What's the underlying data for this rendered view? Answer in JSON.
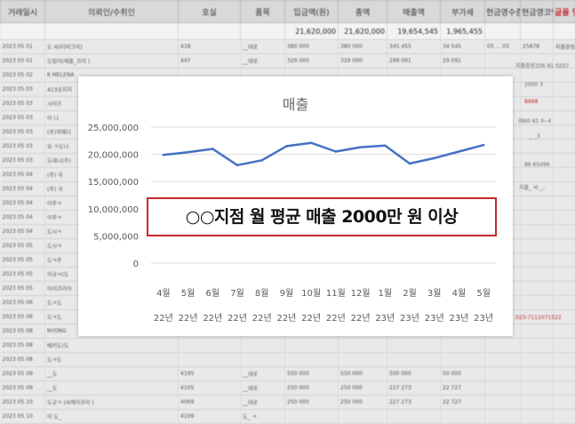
{
  "sheet": {
    "headers": [
      "거래일시",
      "의뢰인/수취인",
      "호실",
      "품목",
      "입금액(원)",
      "총액",
      "매출액",
      "부가세",
      "현금영수증",
      "현금영코멘트",
      "글꼴 및 양식"
    ],
    "totals": [
      "",
      "",
      "",
      "",
      "21,620,000",
      "21,620,000",
      "19,654,545",
      "1,965,455",
      "",
      "",
      ""
    ],
    "rows": [
      [
        "2023 05 01",
        "도  씨(티비크지)",
        "418",
        "__대로",
        "380 000",
        "380 000",
        "345 455",
        "34 545",
        "05 ... 03",
        "25878",
        "지출증빙336 81 0207"
      ],
      [
        "2023 05 01",
        "도팀리(제품_코리 )",
        "447",
        "__대로",
        "329 000",
        "329 000",
        "299 091",
        "29 091",
        "",
        "",
        ""
      ],
      [
        "2023 05 02",
        "K MELENA",
        "",
        "",
        "",
        "",
        "",
        "",
        "",
        "",
        ""
      ],
      [
        "2023 05 03",
        "413호지지",
        "",
        "",
        "",
        "",
        "",
        "",
        "",
        "",
        ""
      ],
      [
        "2023 05 03",
        "시이즈",
        "",
        "",
        "",
        "",
        "",
        "",
        "",
        "",
        ""
      ],
      [
        "2023 05 03",
        "이 니",
        "",
        "",
        "",
        "",
        "",
        "",
        "",
        "",
        ""
      ],
      [
        "2023 05 03",
        "(주)학메디",
        "",
        "",
        "",
        "",
        "",
        "",
        "",
        "",
        ""
      ],
      [
        "2023 05 03",
        "유 ㅋ도니",
        "",
        "",
        "",
        "",
        "",
        "",
        "",
        "",
        ""
      ],
      [
        "2023 05 03",
        "도대니(주)",
        "",
        "",
        "",
        "",
        "",
        "",
        "",
        "",
        ""
      ],
      [
        "2023 05 04",
        "(주) 국",
        "",
        "",
        "",
        "",
        "",
        "",
        "",
        "",
        ""
      ],
      [
        "2023 05 04",
        "(주) 국",
        "",
        "",
        "",
        "",
        "",
        "",
        "",
        "",
        ""
      ],
      [
        "2023 05 04",
        "이주ㅋ",
        "",
        "",
        "",
        "",
        "",
        "",
        "",
        "",
        ""
      ],
      [
        "2023 05 04",
        "이주ㅋ",
        "",
        "",
        "",
        "",
        "",
        "",
        "",
        "",
        ""
      ],
      [
        "2023 05 04",
        "도시ㅋ",
        "",
        "",
        "",
        "",
        "",
        "",
        "",
        "",
        ""
      ],
      [
        "2023 05 05",
        "도시ㅋ",
        "",
        "",
        "",
        "",
        "",
        "",
        "",
        "",
        ""
      ],
      [
        "2023 05 05",
        "도ㅋ주",
        "",
        "",
        "",
        "",
        "",
        "",
        "",
        "",
        ""
      ],
      [
        "2023 05 05",
        "이규ㅋ(도",
        "",
        "",
        "",
        "",
        "",
        "",
        "",
        "",
        ""
      ],
      [
        "2023 05 05",
        "티이코리아",
        "",
        "",
        "",
        "",
        "",
        "",
        "",
        "",
        ""
      ],
      [
        "2023 05 06",
        "도ㅋ도",
        "",
        "",
        "",
        "",
        "",
        "",
        "",
        "",
        ""
      ],
      [
        "2023 05 06",
        "도ㅋ도",
        "",
        "",
        "",
        "",
        "",
        "",
        "",
        "",
        ""
      ],
      [
        "2023 05 08",
        "NYONG",
        "",
        "",
        "",
        "",
        "",
        "",
        "",
        "",
        ""
      ],
      [
        "2023 05 08",
        "베키도(도",
        "",
        "",
        "",
        "",
        "",
        "",
        "",
        "",
        ""
      ],
      [
        "2023 05 08",
        "도ㅋ도",
        "",
        "",
        "",
        "",
        "",
        "",
        "",
        "",
        ""
      ],
      [
        "2023 05 09",
        "__도",
        "4195",
        "__대로",
        "550 000",
        "550 000",
        "500 000",
        "50 000",
        "",
        "",
        ""
      ],
      [
        "2023 05 09",
        "__도",
        "4105",
        "__대로",
        "250 000",
        "250 000",
        "227 273",
        "22 727",
        "",
        "",
        ""
      ],
      [
        "2023 05 10",
        "도규ㅋ (씨에이코리 )",
        "4069",
        "__대로",
        "250 000",
        "250 000",
        "227 273",
        "22 727",
        "",
        "",
        ""
      ],
      [
        "2023 05 10",
        "이 도_",
        "4199",
        "도_ ㅋ",
        "",
        "",
        "",
        "",
        "",
        "",
        ""
      ]
    ],
    "side_notes": [
      "지출증빙336 81 0207",
      "2000 3",
      "8668",
      "(860 61 0--4",
      "_ _3",
      "86 65499",
      "지출_ 씨 _..",
      "023-7111071522"
    ]
  },
  "chart_data": {
    "type": "line",
    "title": "매출",
    "categories": [
      "4월 22년",
      "5월 22년",
      "6월 22년",
      "7월 22년",
      "8월 22년",
      "9월 22년",
      "10월 22년",
      "11월 22년",
      "12월 22년",
      "1월 23년",
      "2월 23년",
      "3월 23년",
      "4월 23년",
      "5월 23년"
    ],
    "x_month_labels": [
      "4월",
      "5월",
      "6월",
      "7월",
      "8월",
      "9월",
      "10월",
      "11월",
      "12월",
      "1월",
      "2월",
      "3월",
      "4월",
      "5월"
    ],
    "x_year_labels": [
      "22년",
      "22년",
      "22년",
      "22년",
      "22년",
      "22년",
      "22년",
      "22년",
      "22년",
      "23년",
      "23년",
      "23년",
      "23년",
      "23년"
    ],
    "series": [
      {
        "values": [
          19900000,
          20400000,
          21000000,
          18000000,
          18900000,
          21500000,
          22100000,
          20500000,
          21300000,
          21600000,
          18300000,
          19300000,
          20500000,
          21700000
        ]
      }
    ],
    "y_ticks": [
      0,
      5000000,
      10000000,
      15000000,
      20000000,
      25000000
    ],
    "y_tick_labels": [
      "0",
      "5,000,000",
      "10,000,000",
      "15,000,000",
      "20,000,000",
      "25,000,000"
    ],
    "ylim": [
      0,
      25000000
    ],
    "grid": true,
    "line_color": "#4472c4",
    "xlabel": "",
    "ylabel": ""
  },
  "callout": {
    "text": "○○지점 월 평균 매출 2000만 원 이상",
    "border_color": "#c62828"
  }
}
